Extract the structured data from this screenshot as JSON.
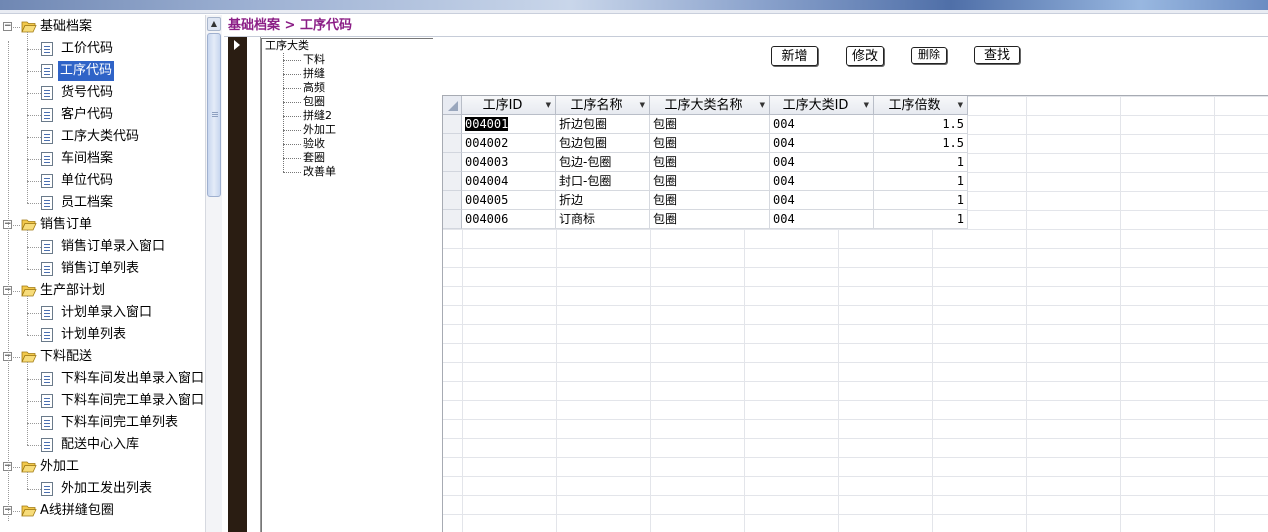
{
  "sidebar": {
    "groups": [
      {
        "label": "基础档案",
        "items": [
          "工价代码",
          "工序代码",
          "货号代码",
          "客户代码",
          "工序大类代码",
          "车间档案",
          "单位代码",
          "员工档案"
        ]
      },
      {
        "label": "销售订单",
        "items": [
          "销售订单录入窗口",
          "销售订单列表"
        ]
      },
      {
        "label": "生产部计划",
        "items": [
          "计划单录入窗口",
          "计划单列表"
        ]
      },
      {
        "label": "下料配送",
        "items": [
          "下料车间发出单录入窗口",
          "下料车间完工单录入窗口",
          "下料车间完工单列表",
          "配送中心入库"
        ]
      },
      {
        "label": "外加工",
        "items": [
          "外加工发出列表"
        ]
      },
      {
        "label": "A线拼缝包圈",
        "items": []
      }
    ],
    "toggle_symbol": "−",
    "scroll_up_symbol": "▲"
  },
  "breadcrumb": "基础档案 > 工序代码",
  "category_tree": {
    "root": "工序大类",
    "items": [
      "下料",
      "拼缝",
      "高频",
      "包圈",
      "拼缝2",
      "外加工",
      "验收",
      "套圈",
      "改善单"
    ]
  },
  "toolbar": {
    "add_label": "新增",
    "edit_label": "修改",
    "delete_label": "删除",
    "find_label": "查找"
  },
  "grid": {
    "columns": [
      "工序ID",
      "工序名称",
      "工序大类名称",
      "工序大类ID",
      "工序倍数"
    ],
    "dropdown_symbol": "▼",
    "rows": [
      [
        "004001",
        "折边包圈",
        "包圈",
        "004",
        "1.5"
      ],
      [
        "004002",
        "包边包圈",
        "包圈",
        "004",
        "1.5"
      ],
      [
        "004003",
        "包边-包圈",
        "包圈",
        "004",
        "1"
      ],
      [
        "004004",
        "封口-包圈",
        "包圈",
        "004",
        "1"
      ],
      [
        "004005",
        "折边",
        "包圈",
        "004",
        "1"
      ],
      [
        "004006",
        "订商标",
        "包圈",
        "004",
        "1"
      ]
    ]
  }
}
